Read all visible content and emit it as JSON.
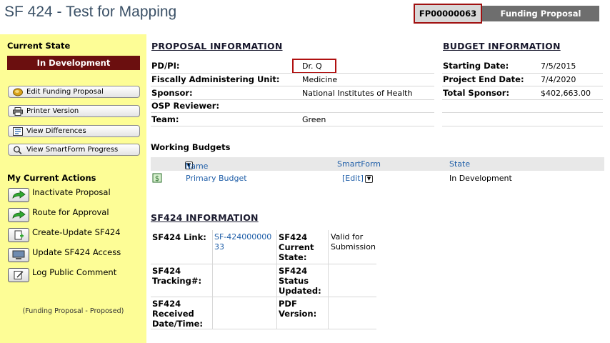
{
  "header": {
    "title": "SF 424 - Test for Mapping",
    "proposal_id": "FP00000063",
    "proposal_type": "Funding Proposal"
  },
  "sidebar": {
    "current_state_heading": "Current State",
    "current_state": "In Development",
    "buttons": [
      {
        "label": "Edit Funding Proposal",
        "icon": "edit-proposal-icon"
      },
      {
        "label": "Printer Version",
        "icon": "printer-icon"
      },
      {
        "label": "View Differences",
        "icon": "differences-icon"
      },
      {
        "label": "View SmartForm Progress",
        "icon": "search-icon"
      }
    ],
    "actions_heading": "My Current Actions",
    "actions": [
      {
        "label": "Inactivate Proposal",
        "icon": "green-arrow-icon"
      },
      {
        "label": "Route for Approval",
        "icon": "green-arrow-icon"
      },
      {
        "label": "Create-Update SF424",
        "icon": "document-add-icon"
      },
      {
        "label": "Update SF424 Access",
        "icon": "monitor-icon"
      },
      {
        "label": "Log Public Comment",
        "icon": "note-edit-icon"
      }
    ],
    "footer": "(Funding Proposal - Proposed)"
  },
  "proposal_info": {
    "title": "PROPOSAL INFORMATION",
    "rows": [
      {
        "label": "PD/PI:",
        "value": "Dr. Q"
      },
      {
        "label": "Fiscally Administering Unit:",
        "value": "Medicine"
      },
      {
        "label": "Sponsor:",
        "value": "National Institutes of Health"
      },
      {
        "label": "OSP Reviewer:",
        "value": ""
      },
      {
        "label": "Team:",
        "value": "Green"
      }
    ]
  },
  "budget_info": {
    "title": "BUDGET INFORMATION",
    "rows": [
      {
        "label": "Starting Date:",
        "value": "7/5/2015"
      },
      {
        "label": "Project End Date:",
        "value": "7/4/2020"
      },
      {
        "label": "Total Sponsor:",
        "value": "$402,663.00"
      }
    ]
  },
  "working_budgets": {
    "title": "Working Budgets",
    "columns": {
      "name": "Name",
      "smartform": "SmartForm",
      "state": "State"
    },
    "rows": [
      {
        "name": "Primary Budget",
        "smartform": "[Edit]",
        "state": "In Development"
      }
    ]
  },
  "sf424": {
    "title": "SF424 INFORMATION",
    "link_label": "SF424 Link:",
    "link_value": "SF-42400000033",
    "current_state_label": "SF424 Current State:",
    "current_state_value": "Valid for Submission",
    "tracking_label": "SF424 Tracking#:",
    "tracking_value": "",
    "status_updated_label": "SF424 Status Updated:",
    "status_updated_value": "",
    "received_label": "SF424 Received Date/Time:",
    "received_value": "",
    "pdf_label": "PDF Version:",
    "pdf_value": ""
  }
}
